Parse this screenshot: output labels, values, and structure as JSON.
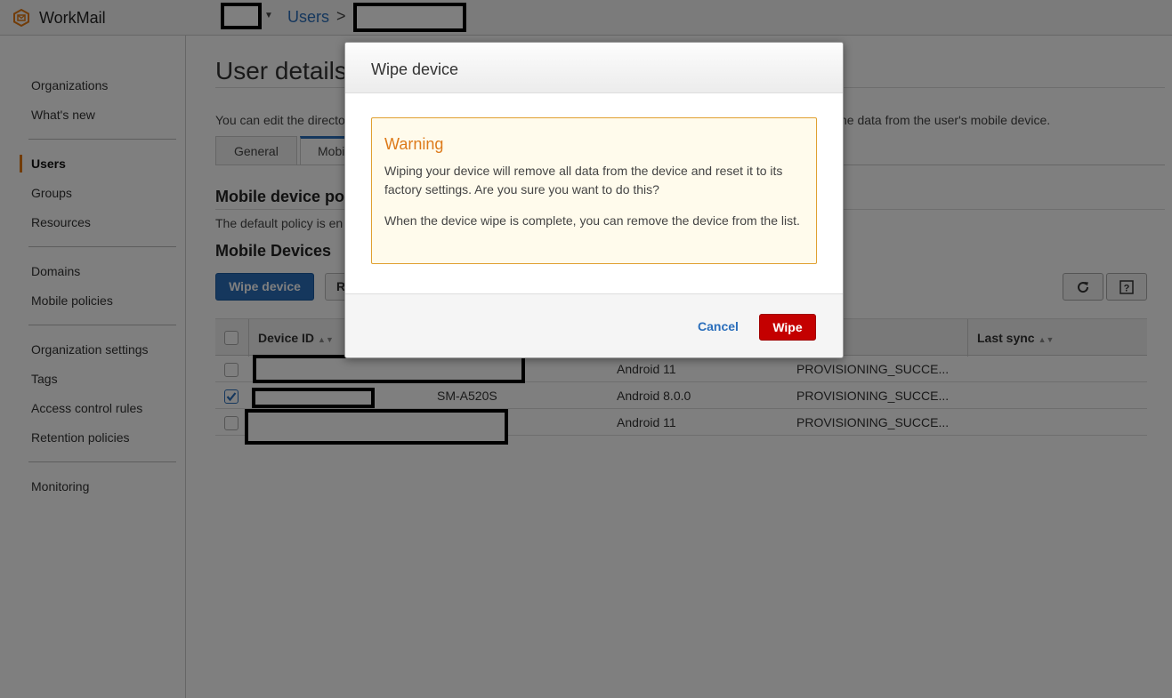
{
  "topbar": {
    "app_name": "WorkMail",
    "breadcrumb_users": "Users",
    "breadcrumb_sep": ">"
  },
  "sidebar": {
    "items": [
      {
        "label": "Organizations"
      },
      {
        "label": "What's new"
      },
      {
        "label": "Users",
        "active": true
      },
      {
        "label": "Groups"
      },
      {
        "label": "Resources"
      },
      {
        "label": "Domains"
      },
      {
        "label": "Mobile policies"
      },
      {
        "label": "Organization settings"
      },
      {
        "label": "Tags"
      },
      {
        "label": "Access control rules"
      },
      {
        "label": "Retention policies"
      },
      {
        "label": "Monitoring"
      }
    ]
  },
  "main": {
    "page_title": "User details",
    "intro_start": "You can edit the directo",
    "intro_end": "he data from the user's mobile device.",
    "tabs": [
      {
        "label": "General"
      },
      {
        "label": "Mobil",
        "active": true
      }
    ],
    "policy_heading": "Mobile device po",
    "policy_text": "The default policy is en",
    "devices_heading": "Mobile Devices",
    "wipe_button": "Wipe device",
    "second_button": "R",
    "table": {
      "headers": [
        "Device ID",
        "",
        "Last sync"
      ],
      "rows": [
        {
          "model": "",
          "os": "Android 11",
          "status": "PROVISIONING_SUCCE...",
          "checked": false
        },
        {
          "model": "SM-A520S",
          "os": "Android 8.0.0",
          "status": "PROVISIONING_SUCCE...",
          "checked": true
        },
        {
          "model": "",
          "os": "Android 11",
          "status": "PROVISIONING_SUCCE...",
          "checked": false
        }
      ]
    }
  },
  "modal": {
    "title": "Wipe device",
    "warning_title": "Warning",
    "warning_p1": "Wiping your device will remove all data from the device and reset it to its factory settings. Are you sure you want to do this?",
    "warning_p2": "When the device wipe is complete, you can remove the device from the list.",
    "cancel_label": "Cancel",
    "wipe_label": "Wipe"
  },
  "colors": {
    "accent": "#2a6ebb",
    "danger": "#c40000",
    "warning": "#dd7a1a",
    "nav_marker": "#e47911"
  },
  "icons": [
    "workmail-logo-icon",
    "chevron-down-icon",
    "refresh-icon",
    "help-icon",
    "sort-icon",
    "checkmark-icon"
  ]
}
